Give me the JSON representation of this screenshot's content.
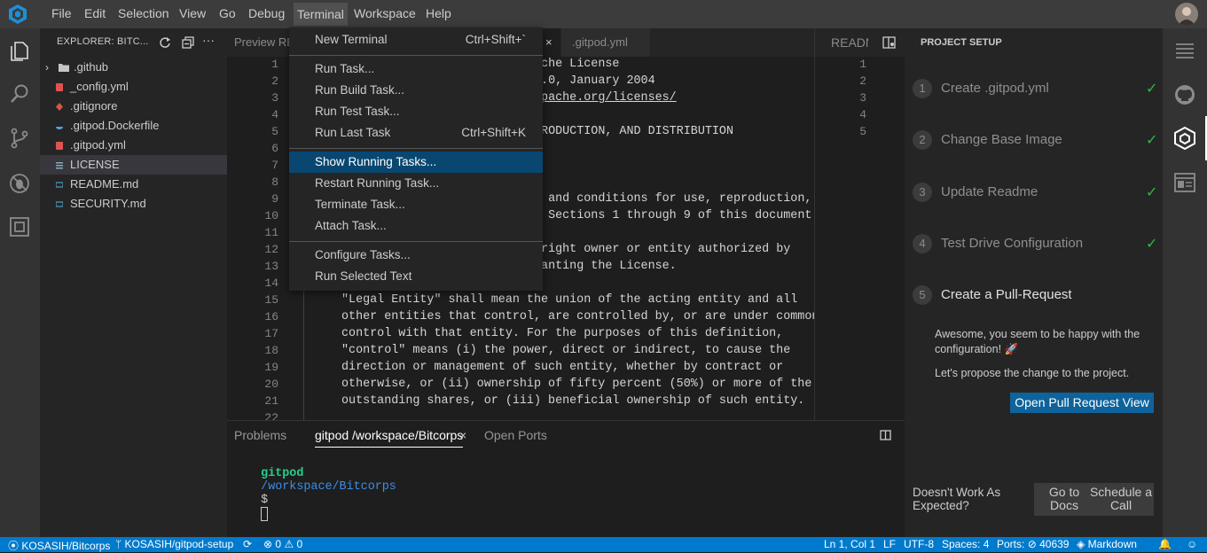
{
  "menubar": {
    "items": [
      "File",
      "Edit",
      "Selection",
      "View",
      "Go",
      "Debug",
      "Terminal",
      "Workspace",
      "Help"
    ]
  },
  "explorer": {
    "title": "EXPLORER: BITC...",
    "items": [
      {
        "label": ".github",
        "icon": "folder-icon"
      },
      {
        "label": "_config.yml",
        "icon": "yaml-file-icon"
      },
      {
        "label": ".gitignore",
        "icon": "git-icon"
      },
      {
        "label": ".gitpod.Dockerfile",
        "icon": "docker-icon"
      },
      {
        "label": ".gitpod.yml",
        "icon": "yaml-file-icon"
      },
      {
        "label": "LICENSE",
        "icon": "text-file-icon"
      },
      {
        "label": "README.md",
        "icon": "markdown-icon"
      },
      {
        "label": "SECURITY.md",
        "icon": "markdown-icon"
      }
    ]
  },
  "tabs": {
    "preview": "Preview RE",
    "gitpod_yml": ".gitpod.yml",
    "readme": "README"
  },
  "terminal_menu": {
    "items": [
      {
        "label": "New Terminal",
        "shortcut": "Ctrl+Shift+`"
      },
      {
        "label": "Run Task..."
      },
      {
        "label": "Run Build Task..."
      },
      {
        "label": "Run Test Task..."
      },
      {
        "label": "Run Last Task",
        "shortcut": "Ctrl+Shift+K"
      },
      {
        "label": "Show Running Tasks..."
      },
      {
        "label": "Restart Running Task..."
      },
      {
        "label": "Terminate Task..."
      },
      {
        "label": "Attach Task..."
      },
      {
        "label": "Configure Tasks..."
      },
      {
        "label": "Run Selected Text"
      }
    ]
  },
  "editor": {
    "line_numbers": [
      "1",
      "2",
      "3",
      "4",
      "5",
      "6",
      "7",
      "8",
      "9",
      "10",
      "11",
      "12",
      "13",
      "14",
      "15",
      "16",
      "17",
      "18",
      "19",
      "20",
      "21",
      "22"
    ],
    "lines": [
      "ache License",
      "2.0, January 2004",
      "apache.org/licenses/",
      "",
      "PRODUCTION, AND DISTRIBUTION",
      "",
      "",
      "",
      "s and conditions for use, reproduction,",
      "y Sections 1 through 9 of this document.",
      "",
      "yright owner or entity authorized by",
      "ranting the License.",
      "",
      "\"Legal Entity\" shall mean the union of the acting entity and all",
      "other entities that control, are controlled by, or are under common",
      "control with that entity. For the purposes of this definition,",
      "\"control\" means (i) the power, direct or indirect, to cause the",
      "direction or management of such entity, whether by contract or",
      "otherwise, or (ii) ownership of fifty percent (50%) or more of the",
      "outstanding shares, or (iii) beneficial ownership of such entity.",
      ""
    ],
    "right_line_numbers": [
      "1",
      "2",
      "3",
      "4",
      "5"
    ]
  },
  "panel": {
    "tabs": {
      "problems": "Problems",
      "terminal": "gitpod /workspace/Bitcorps",
      "ports": "Open Ports"
    },
    "prompt_user": "gitpod",
    "prompt_path": "/workspace/Bitcorps",
    "prompt_symbol": "$"
  },
  "setup": {
    "title": "PROJECT SETUP",
    "steps": [
      {
        "num": "1",
        "label": "Create .gitpod.yml",
        "done": "✓"
      },
      {
        "num": "2",
        "label": "Change Base Image",
        "done": "✓"
      },
      {
        "num": "3",
        "label": "Update Readme",
        "done": "✓"
      },
      {
        "num": "4",
        "label": "Test Drive Configuration",
        "done": "✓"
      },
      {
        "num": "5",
        "label": "Create a Pull-Request"
      }
    ],
    "message_1": "Awesome, you seem to be happy with the configuration! 🚀",
    "message_2": "Let's propose the change to the project.",
    "pr_button": "Open Pull Request View",
    "footer_text": "Doesn't Work As Expected?",
    "docs_button": "Go to Docs",
    "call_button": "Schedule a Call"
  },
  "status": {
    "repo": "KOSASIH/Bitcorps",
    "branch": "KOSASIH/gitpod-setup",
    "errors": "0",
    "warnings": "0",
    "position": "Ln 1, Col 1",
    "eol": "LF",
    "encoding": "UTF-8",
    "spaces": "Spaces: 4",
    "ports": "Ports:",
    "port_num": "40639",
    "language": "Markdown"
  },
  "colors": {
    "accent": "#007acc",
    "highlight": "#094771",
    "check": "#2fb84a"
  }
}
